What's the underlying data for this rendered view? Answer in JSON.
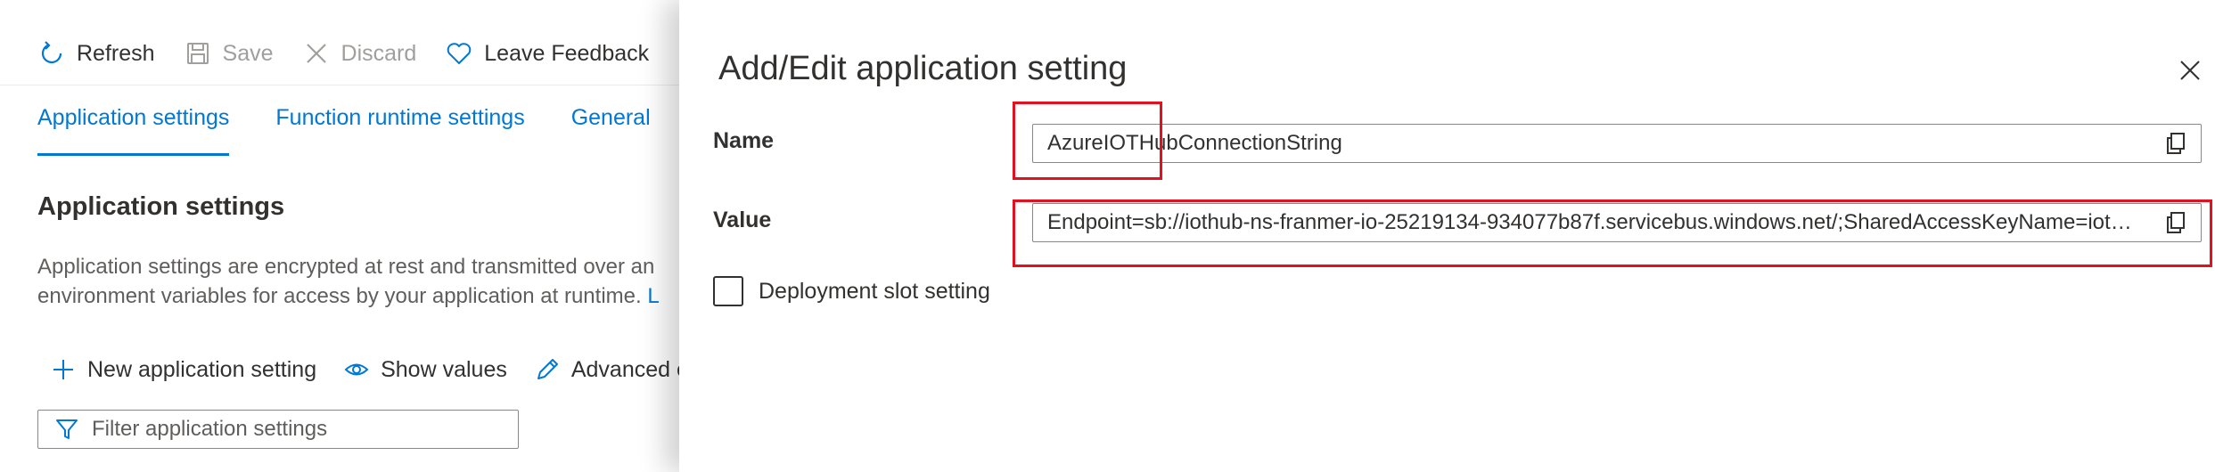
{
  "toolbar": {
    "refresh": "Refresh",
    "save": "Save",
    "discard": "Discard",
    "feedback": "Leave Feedback"
  },
  "tabs": [
    {
      "label": "Application settings",
      "active": true
    },
    {
      "label": "Function runtime settings",
      "active": false
    },
    {
      "label": "General",
      "active": false
    }
  ],
  "section": {
    "title": "Application settings",
    "desc_line1": "Application settings are encrypted at rest and transmitted over an",
    "desc_line2": "environment variables for access by your application at runtime.",
    "desc_link": "L"
  },
  "commands": {
    "new_setting": "New application setting",
    "show_values": "Show values",
    "advanced": "Advanced e"
  },
  "filter": {
    "placeholder": "Filter application settings"
  },
  "panel": {
    "title": "Add/Edit application setting",
    "name_label": "Name",
    "name_value": "AzureIOTHubConnectionString",
    "value_label": "Value",
    "value_value": "Endpoint=sb://iothub-ns-franmer-io-25219134-934077b87f.servicebus.windows.net/;SharedAccessKeyName=iothubowner",
    "slot_label": "Deployment slot setting",
    "slot_checked": false
  },
  "icons": {
    "refresh": "refresh-icon",
    "save": "save-icon",
    "discard": "discard-icon",
    "feedback": "heart-icon",
    "add": "plus-icon",
    "eye": "eye-icon",
    "pencil": "pencil-icon",
    "filter": "filter-icon",
    "close": "close-icon",
    "copy": "copy-icon"
  },
  "colors": {
    "accent": "#0078d4",
    "highlight": "#e3111f",
    "disabled": "#a19f9d"
  }
}
